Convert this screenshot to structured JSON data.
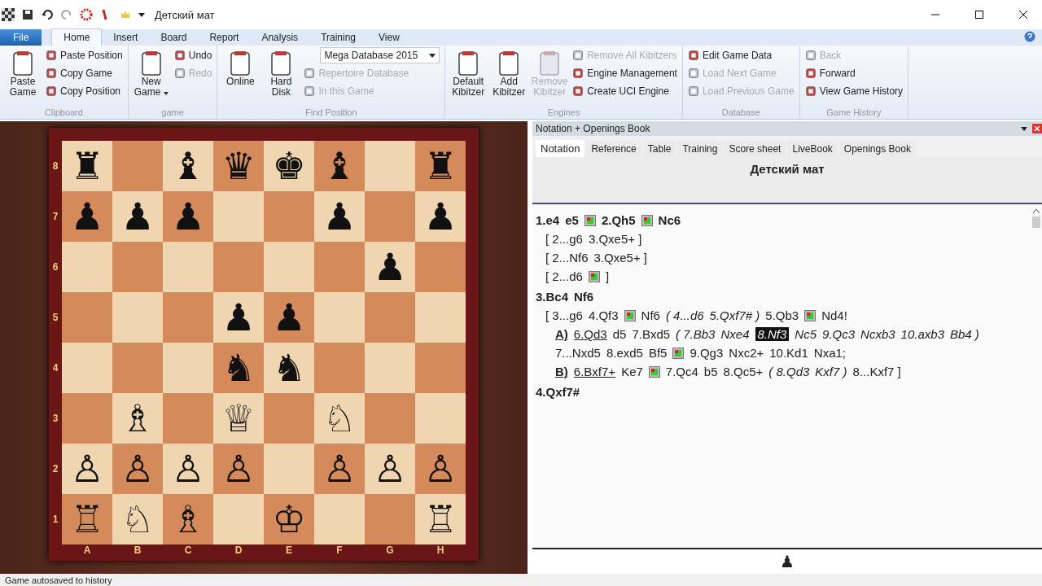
{
  "window": {
    "title": "Детский мат"
  },
  "ribbon": {
    "tabs": [
      {
        "label": "File",
        "kind": "file",
        "selected": false
      },
      {
        "label": "Home",
        "kind": "tab",
        "selected": true
      },
      {
        "label": "Insert",
        "kind": "tab",
        "selected": false
      },
      {
        "label": "Board",
        "kind": "tab",
        "selected": false
      },
      {
        "label": "Report",
        "kind": "tab",
        "selected": false
      },
      {
        "label": "Analysis",
        "kind": "tab",
        "selected": false
      },
      {
        "label": "Training",
        "kind": "tab",
        "selected": false
      },
      {
        "label": "View",
        "kind": "tab",
        "selected": false
      }
    ],
    "groups": [
      {
        "label": "Clipboard",
        "columns": [
          [
            {
              "kind": "large",
              "label": "Paste Game",
              "disabled": false
            }
          ],
          [
            {
              "kind": "small",
              "label": "Paste Position",
              "disabled": false
            },
            {
              "kind": "small",
              "label": "Copy Game",
              "disabled": false
            },
            {
              "kind": "small",
              "label": "Copy Position",
              "disabled": false
            }
          ]
        ]
      },
      {
        "label": "game",
        "columns": [
          [
            {
              "kind": "large",
              "label": "New Game",
              "disabled": false,
              "menu": true
            }
          ],
          [
            {
              "kind": "small",
              "label": "Undo",
              "disabled": false
            },
            {
              "kind": "small",
              "label": "Redo",
              "disabled": true
            }
          ]
        ]
      },
      {
        "label": "Find Position",
        "columns": [
          [
            {
              "kind": "large",
              "label": "Online",
              "disabled": false
            }
          ],
          [
            {
              "kind": "large",
              "label": "Hard Disk",
              "disabled": false
            }
          ],
          [
            {
              "kind": "dropdown",
              "label": "Mega Database 2015"
            },
            {
              "kind": "small",
              "label": "Repertoire Database",
              "disabled": true
            },
            {
              "kind": "small",
              "label": "In this Game",
              "disabled": true
            }
          ]
        ]
      },
      {
        "label": "Engines",
        "columns": [
          [
            {
              "kind": "large",
              "label": "Default Kibitzer",
              "disabled": false
            }
          ],
          [
            {
              "kind": "large",
              "label": "Add Kibitzer",
              "disabled": false
            }
          ],
          [
            {
              "kind": "large",
              "label": "Remove Kibitzer",
              "disabled": true
            }
          ],
          [
            {
              "kind": "small",
              "label": "Remove All Kibitzers",
              "disabled": true
            },
            {
              "kind": "small",
              "label": "Engine Management",
              "disabled": false
            },
            {
              "kind": "small",
              "label": "Create UCI Engine",
              "disabled": false
            }
          ]
        ]
      },
      {
        "label": "Database",
        "columns": [
          [
            {
              "kind": "small",
              "label": "Edit Game Data",
              "disabled": false
            },
            {
              "kind": "small",
              "label": "Load Next Game",
              "disabled": true
            },
            {
              "kind": "small",
              "label": "Load Previous Game",
              "disabled": true
            }
          ]
        ]
      },
      {
        "label": "Game History",
        "columns": [
          [
            {
              "kind": "small",
              "label": "Back",
              "disabled": true
            },
            {
              "kind": "small",
              "label": "Forward",
              "disabled": false
            },
            {
              "kind": "small",
              "label": "View Game History",
              "disabled": false
            }
          ]
        ]
      }
    ]
  },
  "board": {
    "files": [
      "A",
      "B",
      "C",
      "D",
      "E",
      "F",
      "G",
      "H"
    ],
    "ranks": [
      {
        "label": "8",
        "squares": [
          {
            "kind": "piece",
            "glyph": "♜"
          },
          {
            "kind": "empty"
          },
          {
            "kind": "piece",
            "glyph": "♝"
          },
          {
            "kind": "piece",
            "glyph": "♛"
          },
          {
            "kind": "piece",
            "glyph": "♚"
          },
          {
            "kind": "piece",
            "glyph": "♝"
          },
          {
            "kind": "empty"
          },
          {
            "kind": "piece",
            "glyph": "♜"
          }
        ]
      },
      {
        "label": "7",
        "squares": [
          {
            "kind": "piece",
            "glyph": "♟"
          },
          {
            "kind": "piece",
            "glyph": "♟"
          },
          {
            "kind": "piece",
            "glyph": "♟"
          },
          {
            "kind": "empty"
          },
          {
            "kind": "empty"
          },
          {
            "kind": "piece",
            "glyph": "♟"
          },
          {
            "kind": "empty"
          },
          {
            "kind": "piece",
            "glyph": "♟"
          }
        ]
      },
      {
        "label": "6",
        "squares": [
          {
            "kind": "empty"
          },
          {
            "kind": "empty"
          },
          {
            "kind": "empty"
          },
          {
            "kind": "empty"
          },
          {
            "kind": "empty"
          },
          {
            "kind": "empty"
          },
          {
            "kind": "piece",
            "glyph": "♟"
          },
          {
            "kind": "empty"
          }
        ]
      },
      {
        "label": "5",
        "squares": [
          {
            "kind": "empty"
          },
          {
            "kind": "empty"
          },
          {
            "kind": "empty"
          },
          {
            "kind": "piece",
            "glyph": "♟"
          },
          {
            "kind": "piece",
            "glyph": "♟"
          },
          {
            "kind": "empty"
          },
          {
            "kind": "empty"
          },
          {
            "kind": "empty"
          }
        ]
      },
      {
        "label": "4",
        "squares": [
          {
            "kind": "empty"
          },
          {
            "kind": "empty"
          },
          {
            "kind": "empty"
          },
          {
            "kind": "piece",
            "glyph": "♞"
          },
          {
            "kind": "piece",
            "glyph": "♞"
          },
          {
            "kind": "empty"
          },
          {
            "kind": "empty"
          },
          {
            "kind": "empty"
          }
        ]
      },
      {
        "label": "3",
        "squares": [
          {
            "kind": "empty"
          },
          {
            "kind": "piece",
            "glyph": "♗"
          },
          {
            "kind": "empty"
          },
          {
            "kind": "piece",
            "glyph": "♕"
          },
          {
            "kind": "empty"
          },
          {
            "kind": "piece",
            "glyph": "♘"
          },
          {
            "kind": "empty"
          },
          {
            "kind": "empty"
          }
        ]
      },
      {
        "label": "2",
        "squares": [
          {
            "kind": "piece",
            "glyph": "♙"
          },
          {
            "kind": "piece",
            "glyph": "♙"
          },
          {
            "kind": "piece",
            "glyph": "♙"
          },
          {
            "kind": "piece",
            "glyph": "♙"
          },
          {
            "kind": "empty"
          },
          {
            "kind": "piece",
            "glyph": "♙"
          },
          {
            "kind": "piece",
            "glyph": "♙"
          },
          {
            "kind": "piece",
            "glyph": "♙"
          }
        ]
      },
      {
        "label": "1",
        "squares": [
          {
            "kind": "piece",
            "glyph": "♖"
          },
          {
            "kind": "piece",
            "glyph": "♘"
          },
          {
            "kind": "piece",
            "glyph": "♗"
          },
          {
            "kind": "empty"
          },
          {
            "kind": "piece",
            "glyph": "♔"
          },
          {
            "kind": "empty"
          },
          {
            "kind": "empty"
          },
          {
            "kind": "piece",
            "glyph": "♖"
          }
        ]
      }
    ]
  },
  "notation_panel": {
    "title": "Notation + Openings Book",
    "tabs": [
      {
        "label": "Notation",
        "selected": true
      },
      {
        "label": "Reference",
        "selected": false
      },
      {
        "label": "Table",
        "selected": false
      },
      {
        "label": "Training",
        "selected": false
      },
      {
        "label": "Score sheet",
        "selected": false
      },
      {
        "label": "LiveBook",
        "selected": false
      },
      {
        "label": "Openings Book",
        "selected": false
      }
    ],
    "game_title": "Детский мат",
    "lines": [
      {
        "kind": "main",
        "segments": [
          {
            "kind": "move",
            "text": "1.e4"
          },
          {
            "kind": "move",
            "text": "e5"
          },
          {
            "kind": "diagram"
          },
          {
            "kind": "move",
            "text": "2.Qh5"
          },
          {
            "kind": "diagram"
          },
          {
            "kind": "move",
            "text": "Nc6"
          }
        ]
      },
      {
        "kind": "variation",
        "segments": [
          {
            "kind": "move",
            "text": "[ 2...g6"
          },
          {
            "kind": "move",
            "text": "3.Qxe5+ ]"
          }
        ]
      },
      {
        "kind": "variation",
        "segments": [
          {
            "kind": "move",
            "text": "[ 2...Nf6"
          },
          {
            "kind": "move",
            "text": "3.Qxe5+ ]"
          }
        ]
      },
      {
        "kind": "variation",
        "segments": [
          {
            "kind": "move",
            "text": "[ 2...d6"
          },
          {
            "kind": "diagram"
          },
          {
            "kind": "move",
            "text": "]"
          }
        ]
      },
      {
        "kind": "main",
        "segments": [
          {
            "kind": "move",
            "text": "3.Bc4"
          },
          {
            "kind": "move",
            "text": "Nf6"
          }
        ]
      },
      {
        "kind": "variation",
        "segments": [
          {
            "kind": "move",
            "text": "[ 3...g6"
          },
          {
            "kind": "move",
            "text": "4.Qf3"
          },
          {
            "kind": "diagram"
          },
          {
            "kind": "move",
            "text": "Nf6"
          },
          {
            "kind": "italic",
            "text": "( 4...d6"
          },
          {
            "kind": "italic",
            "text": "5.Qxf7# )"
          },
          {
            "kind": "move",
            "text": "5.Qb3"
          },
          {
            "kind": "diagram"
          },
          {
            "kind": "move",
            "text": "Nd4!"
          }
        ]
      },
      {
        "kind": "subvariation",
        "segments": [
          {
            "kind": "label",
            "text": "A)"
          },
          {
            "kind": "underlined",
            "text": "6.Qd3"
          },
          {
            "kind": "move",
            "text": "d5"
          },
          {
            "kind": "move",
            "text": "7.Bxd5"
          },
          {
            "kind": "italic",
            "text": "( 7.Bb3"
          },
          {
            "kind": "italic",
            "text": "Nxe4"
          },
          {
            "kind": "current",
            "text": "8.Nf3"
          },
          {
            "kind": "italic",
            "text": "Nc5"
          },
          {
            "kind": "italic",
            "text": "9.Qc3"
          },
          {
            "kind": "italic",
            "text": "Ncxb3"
          },
          {
            "kind": "italic",
            "text": "10.axb3"
          },
          {
            "kind": "italic",
            "text": "Bb4 )"
          }
        ]
      },
      {
        "kind": "subvariation",
        "segments": [
          {
            "kind": "move",
            "text": "7...Nxd5"
          },
          {
            "kind": "move",
            "text": "8.exd5"
          },
          {
            "kind": "move",
            "text": "Bf5"
          },
          {
            "kind": "diagram"
          },
          {
            "kind": "move",
            "text": "9.Qg3"
          },
          {
            "kind": "move",
            "text": "Nxc2+"
          },
          {
            "kind": "move",
            "text": "10.Kd1"
          },
          {
            "kind": "move",
            "text": "Nxa1;"
          }
        ]
      },
      {
        "kind": "subvariation",
        "segments": [
          {
            "kind": "label",
            "text": "B)"
          },
          {
            "kind": "underlined",
            "text": "6.Bxf7+"
          },
          {
            "kind": "move",
            "text": "Ke7"
          },
          {
            "kind": "diagram"
          },
          {
            "kind": "move",
            "text": "7.Qc4"
          },
          {
            "kind": "move",
            "text": "b5"
          },
          {
            "kind": "move",
            "text": "8.Qc5+"
          },
          {
            "kind": "italic",
            "text": "( 8.Qd3"
          },
          {
            "kind": "italic",
            "text": "Kxf7 )"
          },
          {
            "kind": "move",
            "text": "8...Kxf7 ]"
          }
        ]
      },
      {
        "kind": "main",
        "segments": [
          {
            "kind": "move",
            "text": "4.Qxf7#"
          }
        ]
      }
    ],
    "side_to_move": "♟"
  },
  "status_bar": "Game autosaved to history"
}
